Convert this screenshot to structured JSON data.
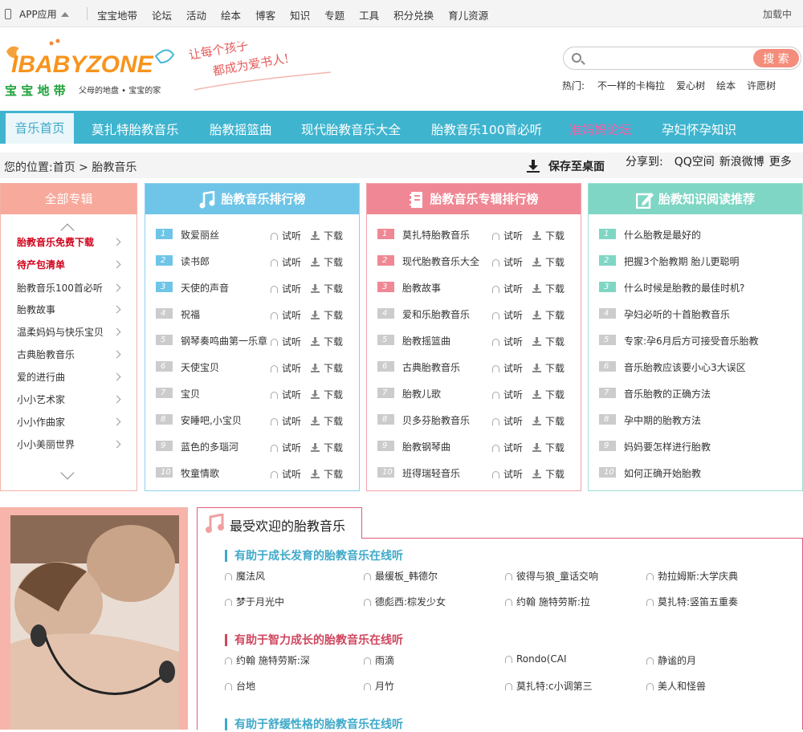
{
  "topbar": {
    "app": "APP应用",
    "nav": [
      "宝宝地带",
      "论坛",
      "活动",
      "绘本",
      "博客",
      "知识",
      "专题",
      "工具",
      "积分兑换",
      "育儿资源"
    ],
    "loading": "加载中"
  },
  "logo": {
    "brand": "IBABYZONE",
    "cn": "宝 宝 地 带",
    "tag": "父母的地盘 • 宝宝的家",
    "slogan1": "让每个孩子",
    "slogan2": "都成为爱书人!"
  },
  "search": {
    "button": "搜 索",
    "placeholder": ""
  },
  "hot": {
    "label": "热门:",
    "items": [
      "不一样的卡梅拉",
      "爱心树",
      "绘本",
      "许愿树"
    ]
  },
  "mainnav": {
    "items": [
      "音乐首页",
      "莫扎特胎教音乐",
      "胎教摇篮曲",
      "现代胎教音乐大全",
      "胎教音乐100首必听",
      "准妈妈论坛",
      "孕妇怀孕知识"
    ]
  },
  "crumb": {
    "label": "您的位置:",
    "home": "首页",
    "sep": ">",
    "current": "胎教音乐",
    "save": "保存至桌面",
    "share": "分享到:",
    "targets": [
      "QQ空间",
      "新浪微博",
      "更多"
    ]
  },
  "albums": {
    "title": "全部专辑",
    "items": [
      "胎教音乐免费下载",
      "待产包清单",
      "胎教音乐100首必听",
      "胎教故事",
      "温柔妈妈与快乐宝贝",
      "古典胎教音乐",
      "爱的进行曲",
      "小小艺术家",
      "小小作曲家",
      "小小美丽世界"
    ]
  },
  "actions": {
    "try": "试听",
    "download": "下载"
  },
  "rank1": {
    "title": "胎教音乐排行榜",
    "color": "#6fc5e8",
    "items": [
      "致爱丽丝",
      "读书郎",
      "天使的声音",
      "祝福",
      "钢琴奏鸣曲第一乐章",
      "天使宝贝",
      "宝贝",
      "安睡吧,小宝贝",
      "蓝色的多瑙河",
      "牧童情歌"
    ]
  },
  "rank2": {
    "title": "胎教音乐专辑排行榜",
    "color": "#ef8894",
    "items": [
      "莫扎特胎教音乐",
      "现代胎教音乐大全",
      "胎教故事",
      "爱和乐胎教音乐",
      "胎教摇篮曲",
      "古典胎教音乐",
      "胎教儿歌",
      "贝多芬胎教音乐",
      "胎教钢琴曲",
      "班得瑞轻音乐"
    ]
  },
  "rank3": {
    "title": "胎教知识阅读推荐",
    "color": "#7fd6c4",
    "items": [
      "什么胎教是最好的",
      "把握3个胎教期 胎儿更聪明",
      "什么时候是胎教的最佳时机?",
      "孕妇必听的十首胎教音乐",
      "专家:孕6月后方可接受音乐胎教",
      "音乐胎教应该要小心3大误区",
      "音乐胎教的正确方法",
      "孕中期的胎教方法",
      "妈妈要怎样进行胎教",
      "如何正确开始胎教"
    ]
  },
  "nums": [
    "1",
    "2",
    "3",
    "4",
    "5",
    "6",
    "7",
    "8",
    "9",
    "10"
  ],
  "popular": {
    "title": "最受欢迎的胎教音乐",
    "sections": [
      {
        "title": "有助于成长发育的胎教音乐在线听",
        "songs": [
          "魔法风",
          "最缓板_韩德尔",
          "彼得与狼_童话交响",
          "勃拉姆斯:大学庆典",
          "梦于月光中",
          "德彪西:棕发少女",
          "约翰 施特劳斯:拉",
          "莫扎特:竖笛五重奏"
        ]
      },
      {
        "title": "有助于智力成长的胎教音乐在线听",
        "songs": [
          "约翰 施特劳斯:深",
          "雨滴",
          "Rondo(CAI",
          "静谧的月",
          "台地",
          "月竹",
          "莫扎特:c小调第三",
          "美人和怪兽"
        ]
      },
      {
        "title": "有助于舒缓性格的胎教音乐在线听",
        "songs": []
      }
    ]
  }
}
